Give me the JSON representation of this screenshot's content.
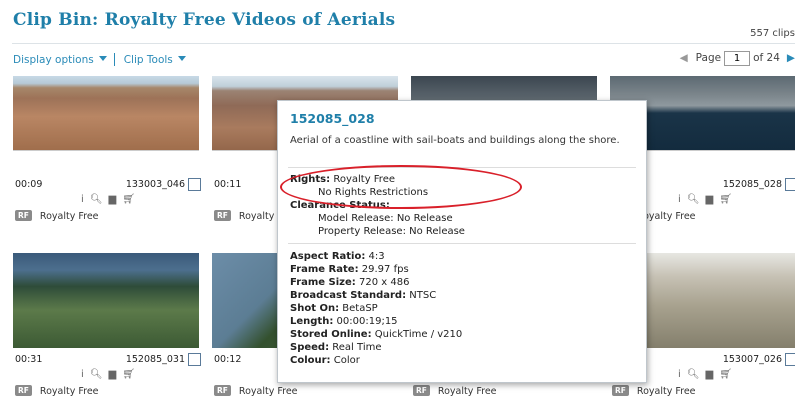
{
  "header": {
    "title": "Clip Bin: Royalty Free Videos of Aerials",
    "clip_count": "557 clips"
  },
  "toolbar": {
    "display_options": "Display options",
    "clip_tools": "Clip Tools"
  },
  "pager": {
    "page_label": "Page",
    "page_value": "1",
    "of_label": "of 24"
  },
  "clips": [
    {
      "duration": "00:09",
      "id": "133003_046",
      "license": "Royalty Free"
    },
    {
      "duration": "00:11",
      "id": "",
      "license": "Royalty Free"
    },
    {
      "duration": "",
      "id": "",
      "license": ""
    },
    {
      "duration": "",
      "id": "152085_028",
      "license": "Royalty Free"
    },
    {
      "duration": "00:31",
      "id": "152085_031",
      "license": "Royalty Free"
    },
    {
      "duration": "00:12",
      "id": "",
      "license": "Royalty Free"
    },
    {
      "duration": "",
      "id": "",
      "license": "Royalty Free"
    },
    {
      "duration": "",
      "id": "153007_026",
      "license": "Royalty Free"
    }
  ],
  "badge": "RF",
  "popup": {
    "id": "152085_028",
    "description": "Aerial of a coastline with sail-boats and buildings along the shore.",
    "rights_label": "Rights:",
    "rights_value": "Royalty Free",
    "rights_note": "No Rights Restrictions",
    "clearance_label": "Clearance Status:",
    "model_release": "Model Release: No Release",
    "property_release": "Property Release: No Release",
    "aspect_label": "Aspect Ratio:",
    "aspect_value": "4:3",
    "framerate_label": "Frame Rate:",
    "framerate_value": "29.97 fps",
    "framesize_label": "Frame Size:",
    "framesize_value": "720 x 486",
    "broadcast_label": "Broadcast Standard:",
    "broadcast_value": "NTSC",
    "shoton_label": "Shot On:",
    "shoton_value": "BetaSP",
    "length_label": "Length:",
    "length_value": "00:00:19;15",
    "stored_label": "Stored Online:",
    "stored_value": "QuickTime / v210",
    "speed_label": "Speed:",
    "speed_value": "Real Time",
    "colour_label": "Colour:",
    "colour_value": "Color"
  },
  "colors": {
    "accent": "#1f7fa9",
    "highlight_oval": "#d9202a"
  },
  "icons": [
    "info-icon",
    "zoom-icon",
    "add-to-bin-icon",
    "cart-icon",
    "dropdown-arrow-icon",
    "prev-page-icon",
    "next-page-icon"
  ]
}
